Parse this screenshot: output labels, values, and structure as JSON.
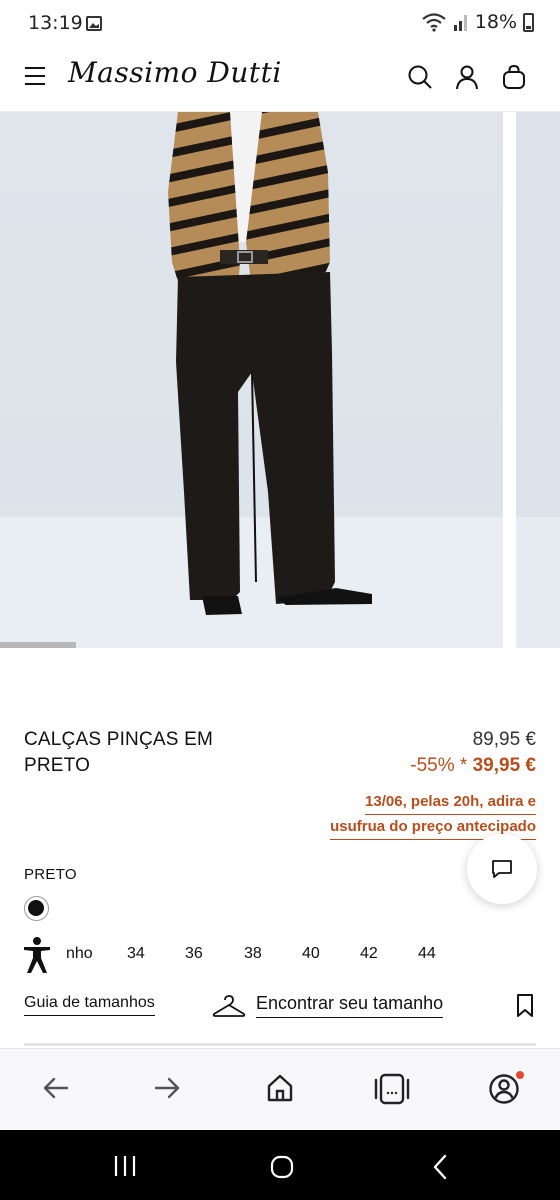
{
  "status_bar": {
    "time": "13:19",
    "battery": "18%"
  },
  "header": {
    "brand": "Massimo Dutti",
    "icons": [
      "menu-icon",
      "search-icon",
      "account-icon",
      "shopping-bag-icon"
    ]
  },
  "product": {
    "title_line1": "CALÇAS PINÇAS EM",
    "title_line2": "PRETO",
    "price_original": "89,95 €",
    "discount": "-55% *",
    "price_sale": "39,95 €",
    "promo_line1": "13/06, pelas 20h, adira e",
    "promo_line2": "usufrua do preço antecipado",
    "color_label": "PRETO",
    "color_hex": "#111111",
    "accent_color": "#b84e1c",
    "size_label_partial": "nho",
    "sizes": [
      "34",
      "36",
      "38",
      "40",
      "42",
      "44"
    ],
    "size_guide": "Guia de tamanhos",
    "find_size": "Encontrar seu tamanho"
  },
  "browser_nav": {
    "icons": [
      "back-arrow-icon",
      "forward-arrow-icon",
      "home-icon",
      "tabs-icon",
      "profile-icon"
    ]
  },
  "system_nav": {
    "icons": [
      "recent-apps-icon",
      "home-circle-icon",
      "back-chevron-icon"
    ]
  }
}
